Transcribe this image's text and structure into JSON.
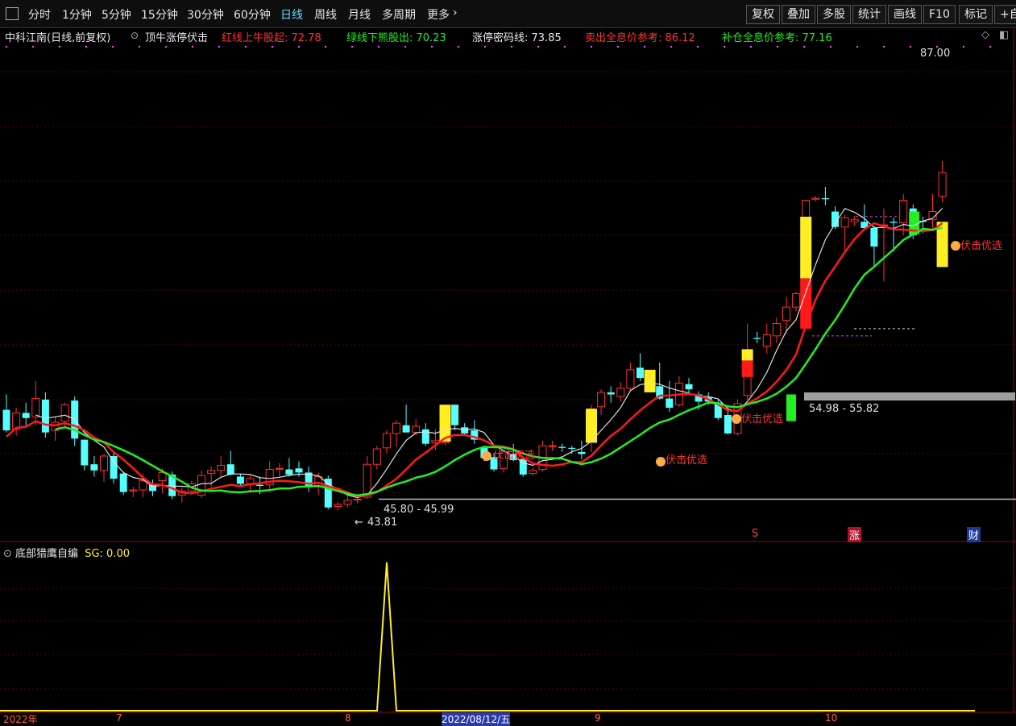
{
  "toolbar": {
    "menu_icon": "window-icon",
    "periods": [
      "分时",
      "1分钟",
      "5分钟",
      "15分钟",
      "30分钟",
      "60分钟",
      "日线",
      "周线",
      "月线",
      "多周期",
      "更多"
    ],
    "more_chevron": "›",
    "buttons": [
      "复权",
      "叠加",
      "多股",
      "统计",
      "画线",
      "F10",
      "标记",
      "+自"
    ]
  },
  "infobar": {
    "stock": "中科江南(日线,前复权)",
    "indicator": "顶牛涨停伏击",
    "red_line": "红线上牛股起: 72.78",
    "green_line": "绿线下熊股出: 70.23",
    "limit_line": "涨停密码线: 73.85",
    "sell_ref": "卖出全息价参考: 86.12",
    "add_ref": "补仓全息价参考: 77.16",
    "arrow": "↑"
  },
  "annotations": {
    "high_price": "87.00",
    "low_price": "43.81",
    "range_low": "45.80 - 45.99",
    "range_high": "54.98 - 55.82",
    "signal_text": "伏击优选",
    "markers": [
      "S",
      "涨",
      "财"
    ]
  },
  "sub_chart": {
    "name": "底部猎鹰自编",
    "sg_label": "SG: 0.00"
  },
  "axis": {
    "labels": [
      "2022年",
      "7",
      "8",
      "2022/08/12/五",
      "9",
      "10"
    ]
  },
  "colors": {
    "up": "#ff3030",
    "down": "#54ffff",
    "ma_white": "#e0e0e0",
    "ma_red": "#ff1a1a",
    "ma_green": "#22ee22",
    "yellow": "#ffee22",
    "label_red": "#ff3333",
    "label_green": "#22ee22"
  },
  "chart_data": {
    "type": "candlestick",
    "ylim": [
      42,
      90
    ],
    "candles": [
      [
        54.5,
        56.0,
        52.3,
        52.5
      ],
      [
        52.6,
        54.7,
        52.0,
        54.2
      ],
      [
        54.2,
        55.2,
        53.0,
        53.7
      ],
      [
        53.8,
        57.3,
        53.0,
        55.6
      ],
      [
        55.5,
        56.2,
        51.8,
        52.3
      ],
      [
        52.5,
        53.8,
        51.5,
        53.3
      ],
      [
        53.4,
        55.2,
        52.9,
        55.0
      ],
      [
        55.4,
        55.8,
        51.0,
        51.7
      ],
      [
        51.6,
        51.6,
        48.6,
        49.1
      ],
      [
        49.2,
        50.0,
        48.0,
        48.6
      ],
      [
        48.6,
        50.2,
        47.5,
        50.0
      ],
      [
        50.0,
        50.5,
        47.3,
        47.8
      ],
      [
        48.3,
        48.5,
        46.2,
        46.5
      ],
      [
        46.6,
        47.0,
        46.0,
        46.7
      ],
      [
        46.7,
        48.3,
        46.0,
        47.6
      ],
      [
        47.2,
        47.7,
        46.1,
        46.6
      ],
      [
        47.6,
        48.8,
        46.4,
        48.4
      ],
      [
        48.2,
        48.5,
        45.8,
        46.1
      ],
      [
        46.2,
        46.9,
        45.5,
        46.6
      ],
      [
        46.6,
        47.6,
        46.3,
        47.3
      ],
      [
        46.2,
        48.6,
        45.9,
        48.1
      ],
      [
        48.3,
        49.0,
        47.0,
        48.6
      ],
      [
        48.6,
        50.0,
        48.0,
        49.1
      ],
      [
        49.2,
        50.5,
        48.1,
        48.2
      ],
      [
        48.0,
        48.3,
        47.0,
        47.3
      ],
      [
        47.3,
        48.1,
        46.4,
        47.8
      ],
      [
        47.2,
        48.0,
        46.3,
        47.1
      ],
      [
        47.2,
        49.5,
        46.6,
        48.7
      ],
      [
        48.8,
        49.3,
        48.0,
        48.8
      ],
      [
        48.7,
        49.8,
        48.0,
        48.2
      ],
      [
        48.8,
        49.5,
        48.0,
        48.4
      ],
      [
        48.4,
        49.0,
        46.5,
        47.0
      ],
      [
        47.0,
        48.4,
        46.2,
        48.0
      ],
      [
        47.8,
        48.1,
        44.8,
        45.0
      ],
      [
        45.1,
        45.5,
        44.7,
        45.3
      ],
      [
        45.3,
        46.1,
        45.0,
        45.7
      ],
      [
        45.8,
        46.1,
        45.4,
        45.8
      ],
      [
        46.0,
        50.0,
        45.8,
        49.2
      ],
      [
        49.2,
        51.0,
        48.7,
        50.7
      ],
      [
        50.8,
        52.5,
        50.3,
        52.2
      ],
      [
        52.2,
        53.5,
        50.9,
        53.2
      ],
      [
        53.0,
        55.0,
        52.3,
        52.3
      ],
      [
        52.3,
        53.6,
        52.0,
        52.9
      ],
      [
        52.6,
        53.2,
        51.0,
        51.2
      ],
      [
        51.3,
        52.6,
        50.6,
        51.5
      ],
      [
        51.3,
        55.0,
        51.0,
        54.9
      ],
      [
        55.0,
        55.0,
        52.5,
        53.0
      ],
      [
        52.8,
        53.2,
        52.0,
        52.2
      ],
      [
        52.5,
        53.5,
        51.2,
        51.6
      ],
      [
        50.8,
        50.9,
        49.5,
        49.8
      ],
      [
        49.9,
        50.3,
        48.5,
        48.7
      ],
      [
        48.8,
        50.6,
        48.4,
        50.4
      ],
      [
        50.2,
        51.2,
        49.5,
        49.6
      ],
      [
        49.7,
        49.9,
        48.0,
        48.2
      ],
      [
        48.3,
        48.9,
        48.1,
        48.6
      ],
      [
        48.7,
        51.5,
        48.5,
        51.0
      ],
      [
        51.0,
        51.5,
        50.5,
        51.0
      ],
      [
        50.9,
        51.2,
        50.4,
        50.8
      ],
      [
        50.8,
        51.0,
        50.2,
        50.7
      ],
      [
        50.4,
        51.5,
        49.7,
        50.2
      ],
      [
        51.6,
        55.0,
        50.4,
        54.6
      ],
      [
        54.8,
        56.5,
        54.0,
        56.2
      ],
      [
        56.2,
        56.8,
        55.2,
        56.0
      ],
      [
        55.8,
        57.2,
        55.3,
        56.6
      ],
      [
        56.6,
        59.1,
        56.3,
        58.4
      ],
      [
        58.6,
        60.0,
        57.3,
        57.6
      ],
      [
        57.2,
        57.8,
        56.5,
        56.8
      ],
      [
        56.8,
        59.1,
        55.5,
        55.6
      ],
      [
        55.6,
        57.3,
        54.3,
        54.7
      ],
      [
        55.0,
        57.8,
        54.8,
        57.1
      ],
      [
        57.0,
        57.6,
        56.0,
        56.5
      ],
      [
        56.0,
        56.3,
        54.5,
        55.3
      ],
      [
        55.7,
        56.2,
        55.0,
        55.3
      ],
      [
        55.2,
        55.5,
        53.5,
        53.7
      ],
      [
        54.0,
        54.5,
        52.1,
        52.2
      ],
      [
        52.2,
        55.5,
        52.0,
        55.1
      ],
      [
        55.9,
        62.9,
        55.5,
        60.3
      ],
      [
        61.5,
        62.1,
        61.0,
        61.4
      ],
      [
        60.7,
        62.9,
        60.0,
        61.8
      ],
      [
        61.7,
        63.5,
        61.0,
        62.9
      ],
      [
        63.2,
        65.5,
        62.0,
        64.5
      ],
      [
        64.5,
        66.0,
        64.1,
        65.8
      ],
      [
        67.0,
        74.9,
        64.5,
        74.9
      ],
      [
        75.0,
        75.3,
        74.8,
        75.1
      ],
      [
        75.1,
        76.2,
        74.4,
        75.0
      ],
      [
        73.8,
        74.3,
        72.1,
        72.3
      ],
      [
        72.3,
        73.5,
        70.0,
        73.2
      ],
      [
        72.8,
        73.4,
        72.4,
        73.0
      ],
      [
        72.8,
        74.5,
        72.2,
        72.2
      ],
      [
        72.2,
        72.4,
        68.5,
        70.4
      ],
      [
        72.5,
        74.1,
        67.0,
        72.5
      ],
      [
        72.8,
        73.2,
        69.9,
        72.7
      ],
      [
        72.7,
        75.5,
        71.5,
        74.9
      ],
      [
        74.1,
        74.5,
        71.1,
        71.5
      ],
      [
        72.9,
        73.3,
        71.7,
        72.8
      ],
      [
        73.0,
        75.5,
        72.0,
        73.8
      ],
      [
        75.3,
        78.7,
        74.7,
        77.6
      ]
    ],
    "boxes": [
      {
        "i": 45,
        "top": 55.0,
        "bottom": 51.4
      },
      {
        "i": 60,
        "top": 54.6,
        "bottom": 51.3
      },
      {
        "i": 66,
        "top": 58.4,
        "bottom": 56.2
      },
      {
        "i": 76,
        "top": 60.4,
        "bottom": 59.3
      },
      {
        "i": 82,
        "top": 73.3,
        "bottom": 67.3
      },
      {
        "i": 96,
        "top": 72.8,
        "bottom": 68.4
      }
    ],
    "red_boxes": [
      {
        "i": 76,
        "top": 59.3,
        "bottom": 57.7
      },
      {
        "i": 82,
        "top": 67.3,
        "bottom": 62.4
      }
    ]
  }
}
